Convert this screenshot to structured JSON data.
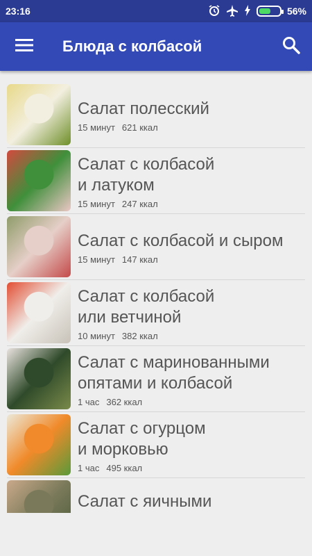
{
  "status": {
    "time": "23:16",
    "battery": "56%",
    "battery_level": 0.56
  },
  "appbar": {
    "title": "Блюда с колбасой",
    "menu_icon": "hamburger-menu-icon",
    "search_icon": "search-icon"
  },
  "recipes": [
    {
      "name": "Салат полесский",
      "time": "15 минут",
      "kcal": "621 ккал",
      "thumb_colors": [
        "#f3efe0",
        "#e8d98a",
        "#6f8f2a"
      ]
    },
    {
      "name": "Салат с колбасой\nи латуком",
      "time": "15 минут",
      "kcal": "247 ккал",
      "thumb_colors": [
        "#3f8f3b",
        "#d24a3f",
        "#eac6c4"
      ]
    },
    {
      "name": "Салат с колбасой и сыром",
      "time": "15 минут",
      "kcal": "147 ккал",
      "thumb_colors": [
        "#e6cfc8",
        "#8f9c6a",
        "#c44a4a"
      ]
    },
    {
      "name": "Салат с колбасой\nили ветчиной",
      "time": "10 минут",
      "kcal": "382 ккал",
      "thumb_colors": [
        "#f0eeea",
        "#e24e33",
        "#c8c2b8"
      ]
    },
    {
      "name": "Салат с маринованными\nопятами и колбасой",
      "time": "1 час",
      "kcal": "362 ккал",
      "thumb_colors": [
        "#2f4a2a",
        "#e9e2df",
        "#7a8a4a"
      ]
    },
    {
      "name": "Салат с огурцом\nи морковью",
      "time": "1 час",
      "kcal": "495 ккал",
      "thumb_colors": [
        "#f08a2a",
        "#ece8d8",
        "#5a9a3a"
      ]
    },
    {
      "name": "Салат с яичными\nблинчиками",
      "time": "",
      "kcal": "",
      "thumb_colors": [
        "#7a7a5a",
        "#c9a98a",
        "#4a5a3a"
      ]
    }
  ]
}
